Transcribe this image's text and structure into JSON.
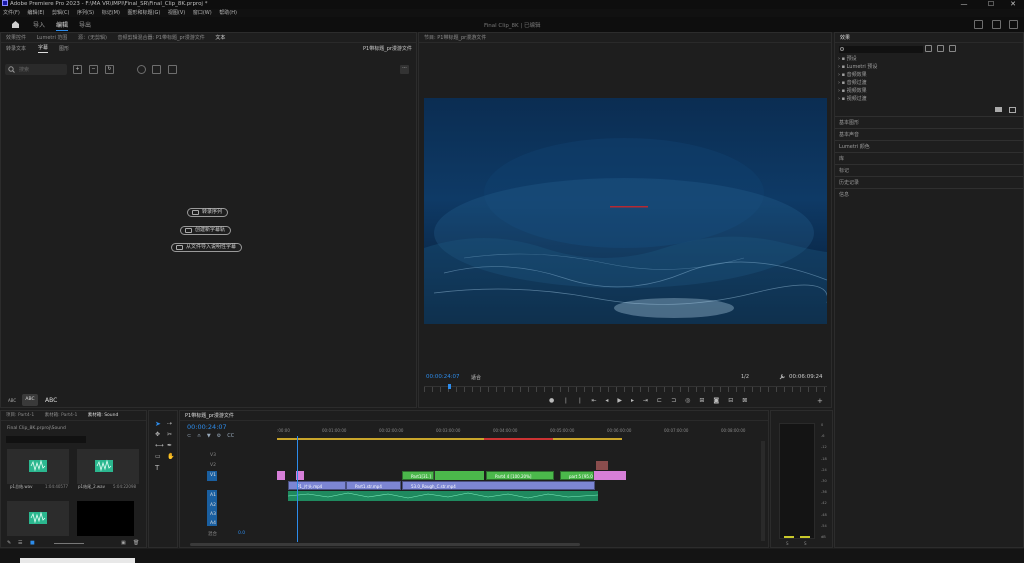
{
  "window": {
    "title": "Adobe Premiere Pro 2023 - F:\\MA VR\\IMPI\\Final_SR\\Final_Clip_8K.prproj *",
    "min": "—",
    "max": "☐",
    "close": "✕"
  },
  "menu": [
    "文件(F)",
    "编辑(E)",
    "剪辑(C)",
    "序列(S)",
    "标记(M)",
    "图形和标题(G)",
    "视图(V)",
    "窗口(W)",
    "帮助(H)"
  ],
  "workspace": {
    "tabs": [
      "导入",
      "编辑",
      "导出"
    ],
    "active": 1,
    "sequence": "Final Clip_8K",
    "sep": "|",
    "extra": "已编辑"
  },
  "text_panel": {
    "tabs": [
      "效果控件",
      "Lumetri 范围",
      "源：(无剪辑)",
      "音频剪辑混合器: P1带标题_pr漫游文件",
      "文本"
    ],
    "subtabs": [
      "转录文本",
      "字幕",
      "图形"
    ],
    "active_subtab": 1,
    "sequence_label": "P1带标题_pr漫游文件",
    "search_placeholder": "搜索",
    "buttons": [
      "转录序列",
      "创建新字幕轨",
      "从文件导入说明性字幕"
    ],
    "bottom": [
      "ABC",
      "ABC",
      "ABC"
    ]
  },
  "program": {
    "tab": "节目: P1带标题_pr漫游文件",
    "timecode": "00:00:24:07",
    "fit": "适合",
    "quality": "1/2",
    "duration": "00:06:09:24"
  },
  "effects": {
    "title": "效果",
    "search_placeholder": "",
    "items": [
      "预设",
      "Lumetri 预设",
      "音频效果",
      "音频过渡",
      "视频效果",
      "视频过渡"
    ],
    "sections": [
      "基本图形",
      "基本声音",
      "Lumetri 颜色",
      "库",
      "标记",
      "历史记录",
      "信息"
    ]
  },
  "project": {
    "tabs": [
      "项目: Part4-1",
      "素材箱: Part4-1",
      "素材箱: Sound"
    ],
    "path": "Final Clip_8K.prproj\\Sound",
    "items": [
      {
        "name": "p1总结.wav",
        "dur": "1:04:40577"
      },
      {
        "name": "p1结尾_2.wav",
        "dur": "5:04:22098"
      },
      {
        "name": "",
        "dur": ""
      },
      {
        "name": "",
        "dur": ""
      }
    ]
  },
  "timeline": {
    "tab": "P1带标题_pr漫游文件",
    "timecode": "00:00:24:07",
    "ruler": [
      ":00:00",
      "00:01:00:00",
      "00:02:00:00",
      "00:03:00:00",
      "00:04:00:00",
      "00:05:00:00",
      "00:06:00:00",
      "00:07:00:00",
      "00:08:00:00"
    ],
    "tracks": [
      "V3",
      "V2",
      "V1",
      "A1",
      "A2",
      "A3",
      "A4",
      "混合"
    ],
    "mix_value": "0.0",
    "clips": [
      {
        "label": "P1_片头.mp4"
      },
      {
        "label": "Part1.str.mp4"
      },
      {
        "label": "53.0_Rough_C.str.mp4"
      },
      {
        "label": "Part1[31.]"
      },
      {
        "label": "Part4 4 [100.20%]"
      },
      {
        "label": "part 5 [95.0"
      }
    ]
  },
  "meter": {
    "scale": [
      "0",
      "-6",
      "-12",
      "-18",
      "-24",
      "-30",
      "-36",
      "-42",
      "-48",
      "-54",
      "dB"
    ],
    "labels": [
      "S",
      "S"
    ]
  },
  "colors": {
    "accent": "#2d8ceb",
    "clip_pink": "#d77fd8",
    "clip_green": "#4bb84b",
    "clip_blue": "#7c86d4",
    "audio_green": "#1f8a5f"
  }
}
